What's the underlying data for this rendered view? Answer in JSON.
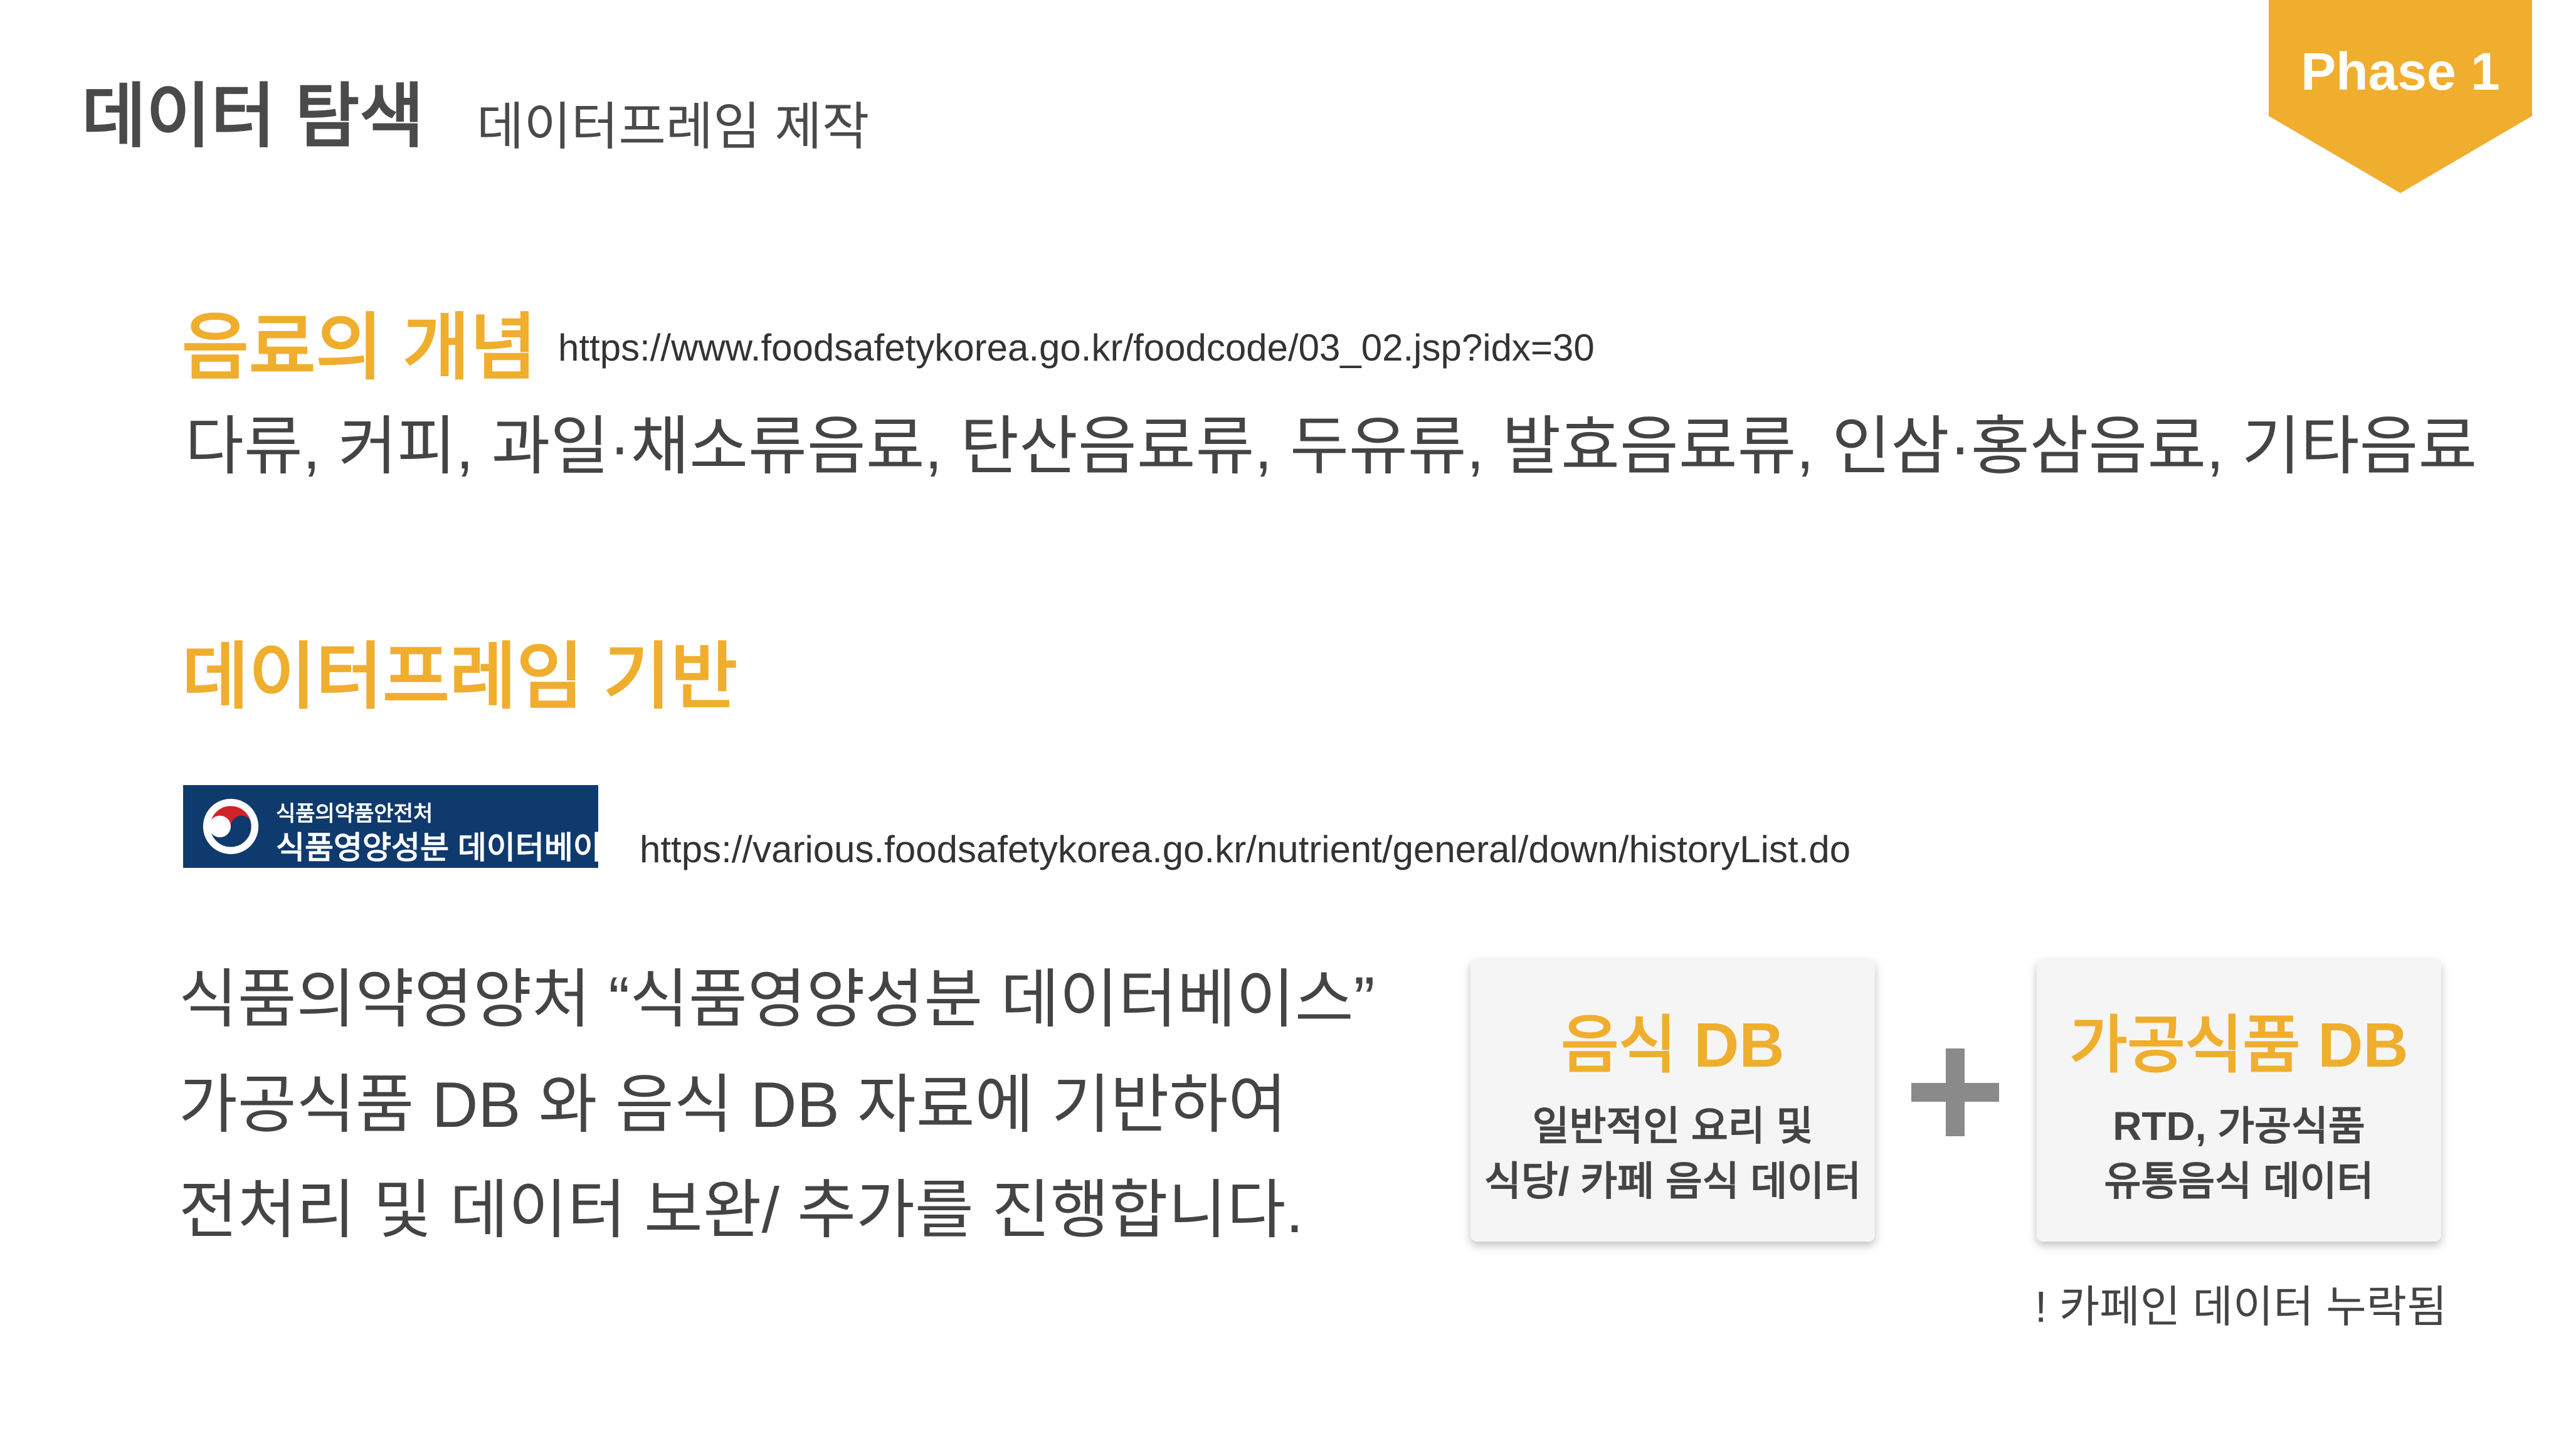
{
  "header": {
    "title": "데이터 탐색",
    "subtitle": "데이터프레임 제작",
    "phase": "Phase 1"
  },
  "section1": {
    "heading": "음료의 개념",
    "url": "https://www.foodsafetykorea.go.kr/foodcode/03_02.jsp?idx=30",
    "body": "다류, 커피, 과일·채소류음료, 탄산음료류, 두유류, 발효음료류, 인삼·홍삼음료, 기타음료"
  },
  "section2": {
    "heading": "데이터프레임 기반",
    "logo": {
      "small_text": "식품의약품안전처",
      "main_text": "식품영양성분 데이터베이스"
    },
    "url": "https://various.foodsafetykorea.go.kr/nutrient/general/down/historyList.do",
    "description": [
      "식품의약영양처 “식품영양성분 데이터베이스”",
      "가공식품 DB 와 음식 DB 자료에 기반하여",
      "전처리 및 데이터 보완/ 추가를 진행합니다."
    ]
  },
  "cards": [
    {
      "title": "음식 DB",
      "desc_line1": "일반적인 요리 및",
      "desc_line2": "식당/ 카페 음식 데이터"
    },
    {
      "title": "가공식품 DB",
      "desc_line1": "RTD, 가공식품",
      "desc_line2": "유통음식 데이터"
    }
  ],
  "note": "! 카페인 데이터 누락됨",
  "colors": {
    "accent": "#f0ae2e",
    "text": "#444444",
    "logo_bg": "#0f3a6e",
    "plus": "#8a8a8a"
  },
  "icons": {
    "plus": "plus-icon",
    "emblem": "taegeuk-emblem-icon"
  }
}
